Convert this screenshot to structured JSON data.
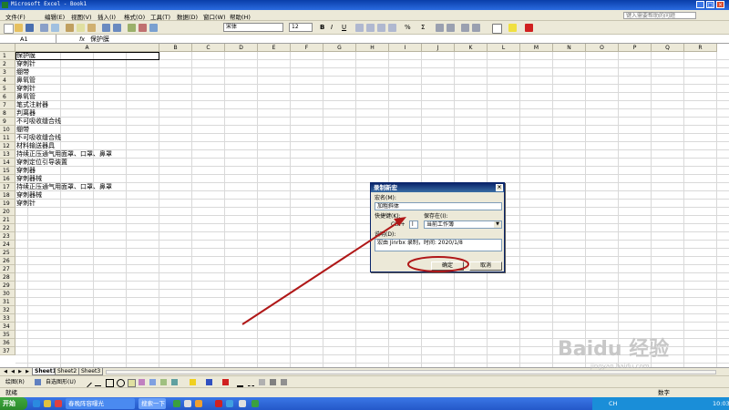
{
  "window": {
    "title": "Microsoft Excel - Book1",
    "minimize": "_",
    "restore": "□",
    "close": "×"
  },
  "menu": {
    "items": [
      "文件(F)",
      "编辑(E)",
      "视图(V)",
      "插入(I)",
      "格式(O)",
      "工具(T)",
      "数据(D)",
      "窗口(W)",
      "帮助(H)"
    ],
    "help_placeholder": "键入需要帮助的问题"
  },
  "toolbar": {
    "font": "宋体",
    "font_size": "12",
    "bold": "B",
    "italic": "I",
    "underline": "U",
    "percent": "%",
    "sum": "Σ"
  },
  "formula_bar": {
    "cell_ref": "A1",
    "fx": "fx",
    "content": "保护膜"
  },
  "grid": {
    "columns": [
      "A",
      "B",
      "C",
      "D",
      "E",
      "F",
      "G",
      "H",
      "I",
      "J",
      "K",
      "L",
      "M",
      "N",
      "O",
      "P",
      "Q",
      "R"
    ],
    "rows": [
      "1",
      "2",
      "3",
      "4",
      "5",
      "6",
      "7",
      "8",
      "9",
      "10",
      "11",
      "12",
      "13",
      "14",
      "15",
      "16",
      "17",
      "18",
      "19",
      "20",
      "21",
      "22",
      "23",
      "24",
      "25",
      "26",
      "27",
      "28",
      "29",
      "30",
      "31",
      "32",
      "33",
      "34",
      "35",
      "36",
      "37"
    ],
    "columnA": [
      "保护膜",
      "穿刺针",
      "绷带",
      "鼻氧管",
      "穿刺针",
      "鼻氧管",
      "笔式注射器",
      "判离器",
      "不可吸收缝合线",
      "绷带",
      "不可吸收缝合线",
      "材料输送器具",
      "持续正压通气用面罩、口罩、鼻罩",
      "穿刺定位引导装置",
      "穿刺器",
      "穿刺器械",
      "持续正压通气用面罩、口罩、鼻罩",
      "穿刺器械",
      "穿刺针"
    ]
  },
  "sheets": {
    "tabs": [
      "Sheet1",
      "Sheet2",
      "Sheet3"
    ],
    "active": 0
  },
  "drawing_toolbar": {
    "draw": "绘图(R)",
    "autoshapes": "自选图形(U)"
  },
  "status": {
    "left": "就绪",
    "right": "数字"
  },
  "dialog": {
    "title": "录制新宏",
    "macro_name_label": "宏名(M):",
    "macro_name_value": "加粗斜体",
    "shortcut_label": "快捷键(K):",
    "ctrl_label": "Ctrl+",
    "shortcut_value": "l",
    "store_label": "保存在(I):",
    "store_value": "当前工作簿",
    "desc_label": "说明(D):",
    "desc_value": "宏由 Jinrbx 录制，时间: 2020/1/8",
    "ok": "确定",
    "cancel": "取消"
  },
  "taskbar": {
    "start": "开始",
    "apps": [
      "春晚阵容曝光",
      "搜索一下"
    ],
    "tray_text": "CH",
    "clock": "10:03"
  },
  "watermark": {
    "text": "Baidu 经验",
    "sub": "jingyan.baidu.com"
  },
  "colors": {
    "annotation": "#b01818",
    "title_blue": "#0a246a"
  }
}
